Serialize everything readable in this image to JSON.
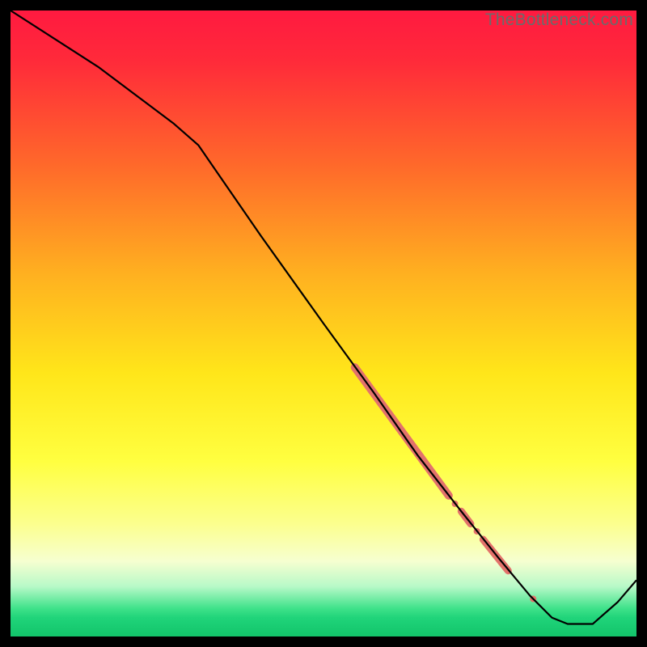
{
  "watermark": "TheBottleneck.com",
  "chart_data": {
    "type": "line",
    "title": "",
    "xlabel": "",
    "ylabel": "",
    "xlim": [
      0,
      100
    ],
    "ylim": [
      0,
      100
    ],
    "gradient_stops": [
      {
        "offset": 0.0,
        "color": "#ff1a40"
      },
      {
        "offset": 0.08,
        "color": "#ff2a3a"
      },
      {
        "offset": 0.25,
        "color": "#ff6a2a"
      },
      {
        "offset": 0.42,
        "color": "#ffb020"
      },
      {
        "offset": 0.58,
        "color": "#ffe61a"
      },
      {
        "offset": 0.72,
        "color": "#ffff40"
      },
      {
        "offset": 0.82,
        "color": "#fcff8e"
      },
      {
        "offset": 0.88,
        "color": "#f6ffd0"
      },
      {
        "offset": 0.92,
        "color": "#b8f9c8"
      },
      {
        "offset": 0.955,
        "color": "#3fe28a"
      },
      {
        "offset": 0.97,
        "color": "#20d47a"
      },
      {
        "offset": 1.0,
        "color": "#12c46a"
      }
    ],
    "series": [
      {
        "name": "curve",
        "x": [
          0.0,
          7.0,
          14.0,
          20.0,
          26.0,
          30.0,
          40.0,
          50.0,
          58.0,
          65.0,
          72.0,
          78.0,
          83.0,
          86.5,
          89.0,
          93.0,
          97.0,
          100.0
        ],
        "y": [
          100.0,
          95.5,
          91.0,
          86.5,
          82.0,
          78.5,
          64.0,
          50.0,
          39.0,
          29.0,
          20.0,
          12.5,
          6.5,
          3.0,
          2.0,
          2.0,
          5.5,
          9.0
        ]
      }
    ],
    "highlight_segments": [
      {
        "x0": 55.0,
        "y0": 43.0,
        "x1": 70.0,
        "y1": 22.5,
        "width": 10
      },
      {
        "x0": 72.0,
        "y0": 20.0,
        "x1": 73.5,
        "y1": 18.0,
        "width": 9
      },
      {
        "x0": 75.5,
        "y0": 15.5,
        "x1": 79.5,
        "y1": 10.5,
        "width": 9
      }
    ],
    "highlight_dots": [
      {
        "x": 71.0,
        "y": 21.2,
        "r": 4
      },
      {
        "x": 74.5,
        "y": 16.8,
        "r": 4
      },
      {
        "x": 83.5,
        "y": 6.0,
        "r": 4
      }
    ],
    "highlight_color": "#e2726b"
  }
}
